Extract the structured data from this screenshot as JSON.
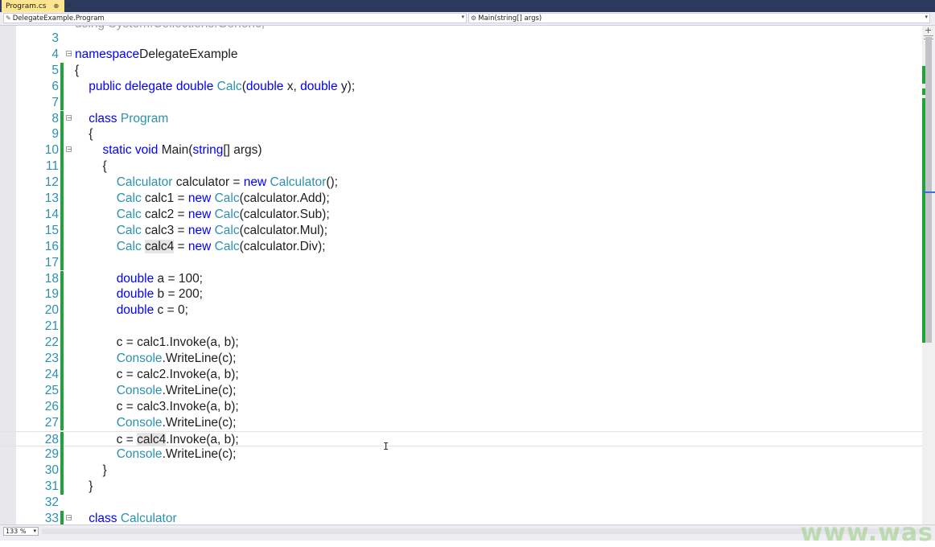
{
  "tab": {
    "name": "Program.cs",
    "pin": "⊕",
    "close": "✕"
  },
  "navbar": {
    "left": "DelegateExample.Program",
    "right": "Main(string[] args)",
    "left_icon": "class-icon",
    "right_icon": "method-icon"
  },
  "editor": {
    "lines": [
      {
        "n": "3",
        "parts": []
      },
      {
        "n": "4",
        "parts": [
          [
            "kw",
            "namespace"
          ],
          [
            "",
            "DelegateExample"
          ]
        ]
      },
      {
        "n": "5",
        "parts": [
          [
            "",
            "{"
          ]
        ]
      },
      {
        "n": "6",
        "parts": [
          [
            "",
            "    "
          ],
          [
            "kw",
            "public delegate double "
          ],
          [
            "ty",
            "Calc"
          ],
          [
            "",
            "("
          ],
          [
            "kw",
            "double"
          ],
          [
            "",
            " x, "
          ],
          [
            "kw",
            "double"
          ],
          [
            "",
            " y);"
          ]
        ]
      },
      {
        "n": "7",
        "parts": []
      },
      {
        "n": "8",
        "parts": [
          [
            "",
            "    "
          ],
          [
            "kw",
            "class "
          ],
          [
            "ty",
            "Program"
          ]
        ]
      },
      {
        "n": "9",
        "parts": [
          [
            "",
            "    {"
          ]
        ]
      },
      {
        "n": "10",
        "parts": [
          [
            "",
            "        "
          ],
          [
            "kw",
            "static void "
          ],
          [
            "",
            "Main("
          ],
          [
            "kw",
            "string"
          ],
          [
            "",
            "[] args)"
          ]
        ]
      },
      {
        "n": "11",
        "parts": [
          [
            "",
            "        {"
          ]
        ]
      },
      {
        "n": "12",
        "parts": [
          [
            "",
            "            "
          ],
          [
            "ty",
            "Calculator"
          ],
          [
            "",
            " calculator = "
          ],
          [
            "kw",
            "new "
          ],
          [
            "ty",
            "Calculator"
          ],
          [
            "",
            "();"
          ]
        ]
      },
      {
        "n": "13",
        "parts": [
          [
            "",
            "            "
          ],
          [
            "ty",
            "Calc"
          ],
          [
            "",
            " calc1 = "
          ],
          [
            "kw",
            "new "
          ],
          [
            "ty",
            "Calc"
          ],
          [
            "",
            "(calculator.Add);"
          ]
        ]
      },
      {
        "n": "14",
        "parts": [
          [
            "",
            "            "
          ],
          [
            "ty",
            "Calc"
          ],
          [
            "",
            " calc2 = "
          ],
          [
            "kw",
            "new "
          ],
          [
            "ty",
            "Calc"
          ],
          [
            "",
            "(calculator.Sub);"
          ]
        ]
      },
      {
        "n": "15",
        "parts": [
          [
            "",
            "            "
          ],
          [
            "ty",
            "Calc"
          ],
          [
            "",
            " calc3 = "
          ],
          [
            "kw",
            "new "
          ],
          [
            "ty",
            "Calc"
          ],
          [
            "",
            "(calculator.Mul);"
          ]
        ]
      },
      {
        "n": "16",
        "parts": [
          [
            "",
            "            "
          ],
          [
            "ty",
            "Calc"
          ],
          [
            "",
            " "
          ],
          [
            "hl",
            "calc4"
          ],
          [
            "",
            " = "
          ],
          [
            "kw",
            "new "
          ],
          [
            "ty",
            "Calc"
          ],
          [
            "",
            "(calculator.Div);"
          ]
        ]
      },
      {
        "n": "17",
        "parts": []
      },
      {
        "n": "18",
        "parts": [
          [
            "",
            "            "
          ],
          [
            "kw",
            "double"
          ],
          [
            "",
            " a = 100;"
          ]
        ]
      },
      {
        "n": "19",
        "parts": [
          [
            "",
            "            "
          ],
          [
            "kw",
            "double"
          ],
          [
            "",
            " b = 200;"
          ]
        ]
      },
      {
        "n": "20",
        "parts": [
          [
            "",
            "            "
          ],
          [
            "kw",
            "double"
          ],
          [
            "",
            " c = 0;"
          ]
        ]
      },
      {
        "n": "21",
        "parts": []
      },
      {
        "n": "22",
        "parts": [
          [
            "",
            "            c = calc1.Invoke(a, b);"
          ]
        ]
      },
      {
        "n": "23",
        "parts": [
          [
            "",
            "            "
          ],
          [
            "ty",
            "Console"
          ],
          [
            "",
            ".WriteLine(c);"
          ]
        ]
      },
      {
        "n": "24",
        "parts": [
          [
            "",
            "            c = calc2.Invoke(a, b);"
          ]
        ]
      },
      {
        "n": "25",
        "parts": [
          [
            "",
            "            "
          ],
          [
            "ty",
            "Console"
          ],
          [
            "",
            ".WriteLine(c);"
          ]
        ]
      },
      {
        "n": "26",
        "parts": [
          [
            "",
            "            c = calc3.Invoke(a, b);"
          ]
        ]
      },
      {
        "n": "27",
        "parts": [
          [
            "",
            "            "
          ],
          [
            "ty",
            "Console"
          ],
          [
            "",
            ".WriteLine(c);"
          ]
        ]
      },
      {
        "n": "28",
        "parts": [
          [
            "",
            "            c = "
          ],
          [
            "hl",
            "calc4"
          ],
          [
            "",
            ".Invoke(a, b);"
          ]
        ]
      },
      {
        "n": "29",
        "parts": [
          [
            "",
            "            "
          ],
          [
            "ty",
            "Console"
          ],
          [
            "",
            ".WriteLine(c);"
          ]
        ]
      },
      {
        "n": "30",
        "parts": [
          [
            "",
            "        }"
          ]
        ]
      },
      {
        "n": "31",
        "parts": [
          [
            "",
            "    }"
          ]
        ]
      },
      {
        "n": "32",
        "parts": []
      },
      {
        "n": "33",
        "parts": [
          [
            "",
            "    "
          ],
          [
            "kw",
            "class "
          ],
          [
            "ty",
            "Calculator"
          ]
        ]
      }
    ]
  },
  "statusbar": {
    "zoom": "133 %",
    "zoom_arrow": "▾"
  },
  "watermark": "www.was",
  "colors": {
    "keyword": "#0000ff",
    "type": "#2b91af",
    "line_number": "#2b91af",
    "change_bar": "#21a33a",
    "tab_active": "#ffe58e"
  }
}
